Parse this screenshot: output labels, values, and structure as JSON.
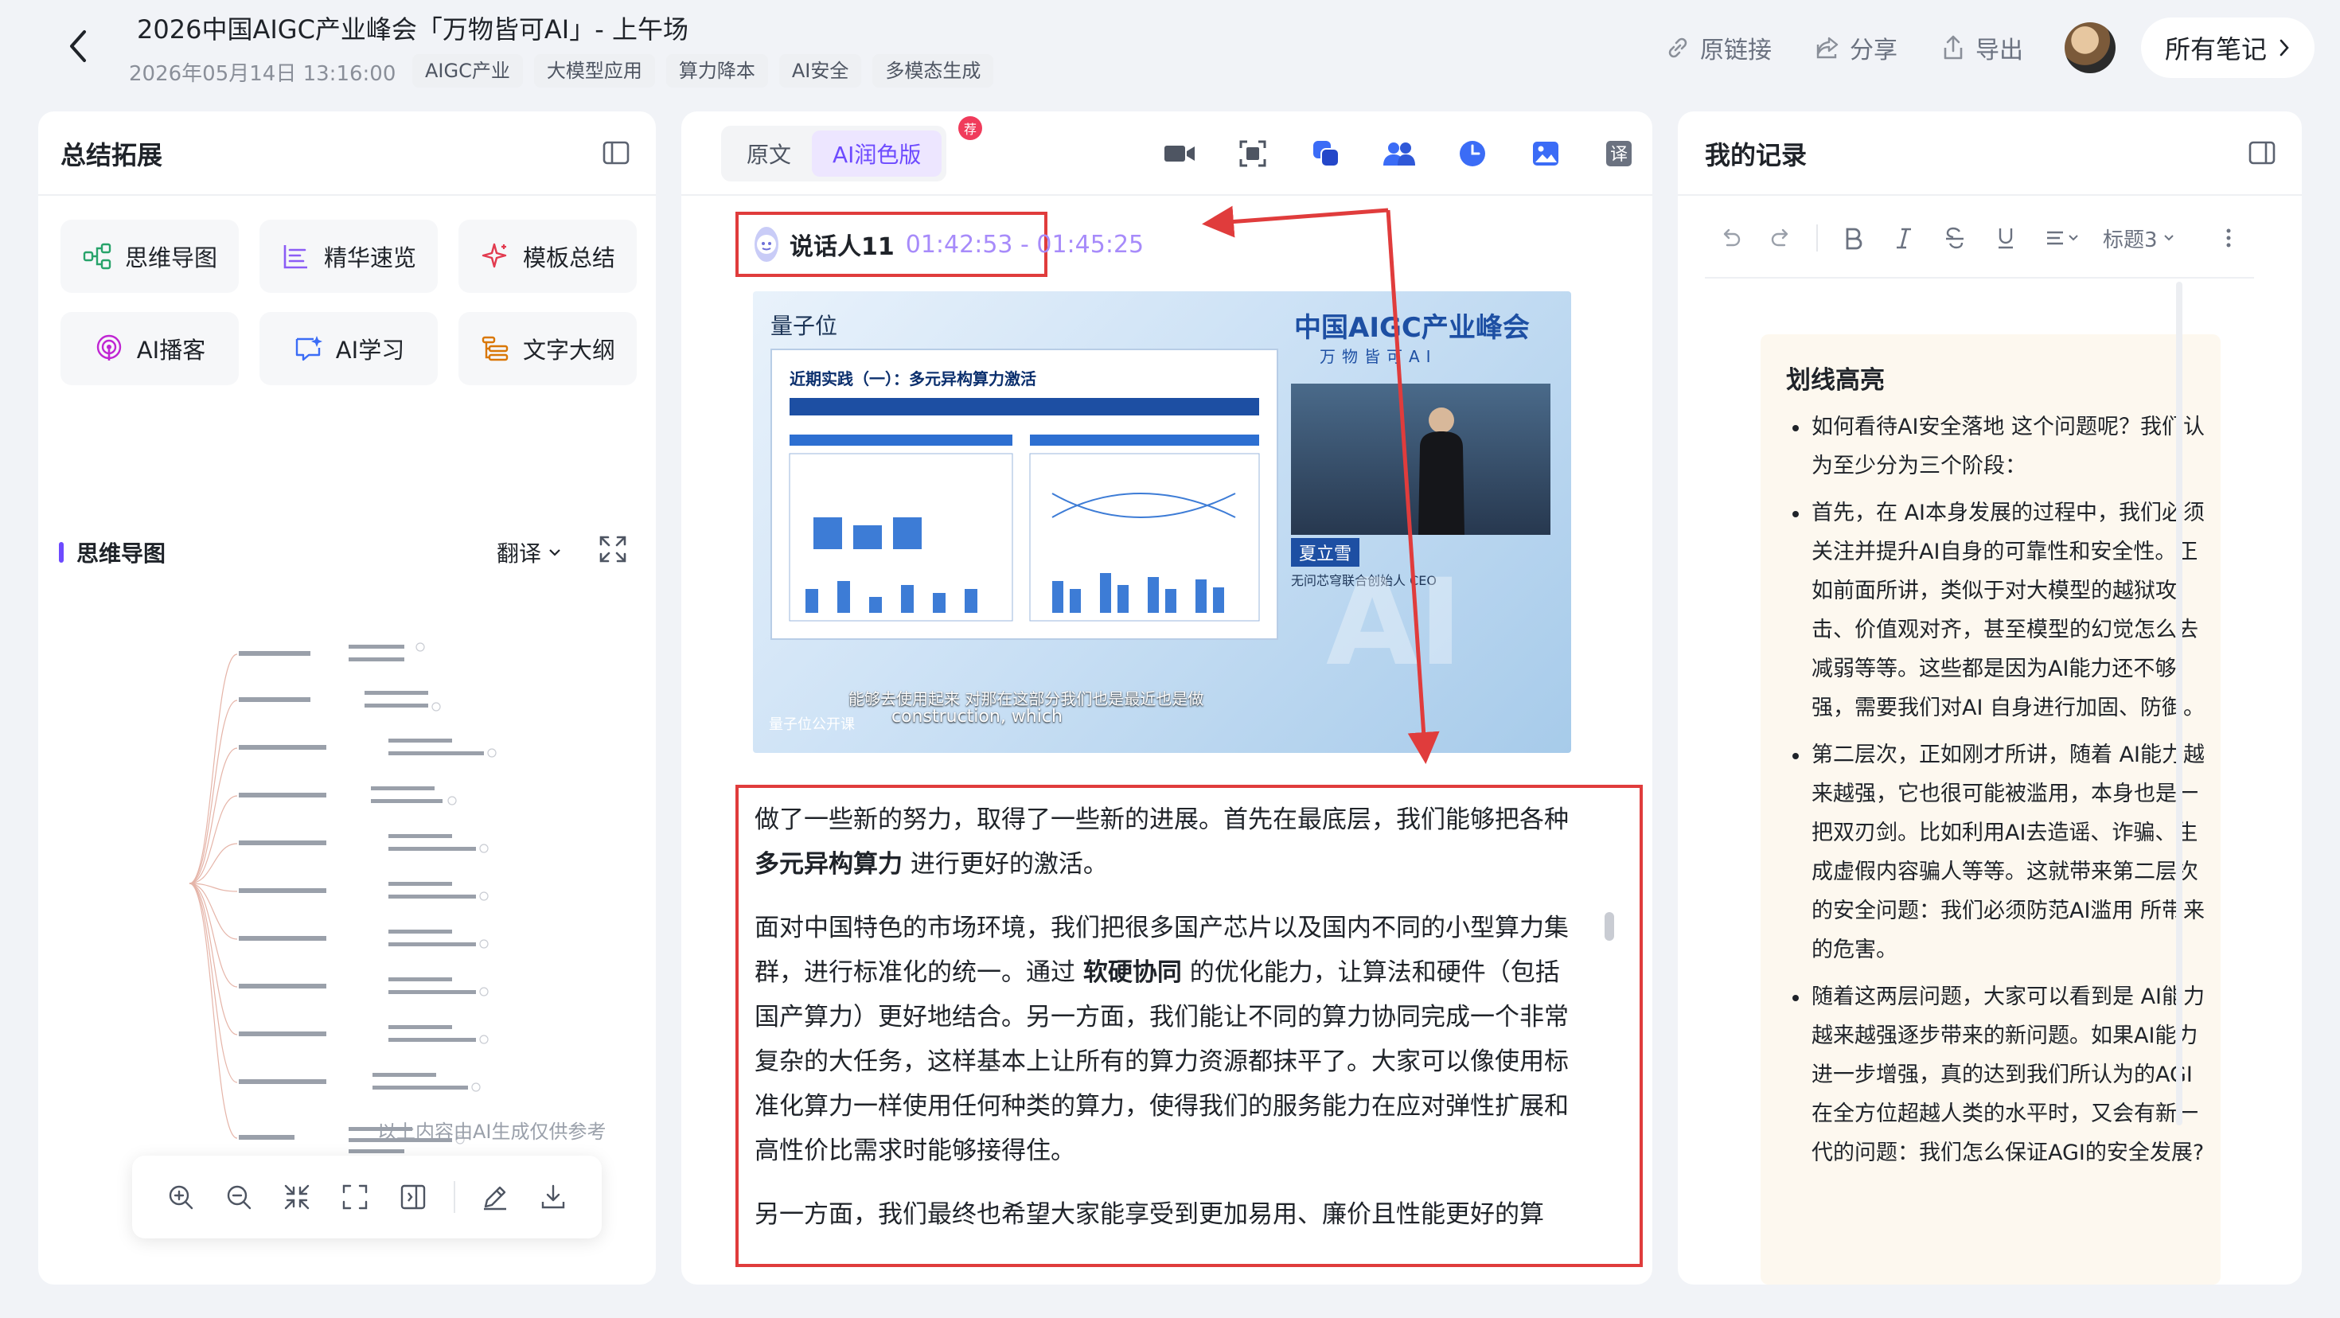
{
  "header": {
    "title": "2026中国AIGC产业峰会「万物皆可AI」- 上午场",
    "datetime": "2026年05月14日 13:16:00",
    "tags": [
      "AIGC产业",
      "大模型应用",
      "算力降本",
      "AI安全",
      "多模态生成"
    ],
    "actions": {
      "origin_link": "原链接",
      "share": "分享",
      "export": "导出"
    },
    "all_notes": "所有笔记"
  },
  "left": {
    "title": "总结拓展",
    "tools": [
      "思维导图",
      "精华速览",
      "模板总结",
      "AI播客",
      "AI学习",
      "文字大纲"
    ],
    "mindmap_title": "思维导图",
    "translate": "翻译",
    "ai_note": "以上内容由AI生成仅供参考"
  },
  "middle": {
    "tabs": [
      "原文",
      "AI润色版"
    ],
    "badge": "荐",
    "speaker": "说话人11",
    "time_range": "01:42:53 - 01:45:25",
    "video": {
      "brand": "量子位",
      "conference": "中国AIGC产业峰会",
      "conference_sub": "万物皆可AI",
      "slide_title": "近期实践（一）：多元异构算力激活",
      "speaker_name": "夏立雪",
      "speaker_role": "无问芯穹联合创始人 CEO",
      "subtitle_cn": "能够去使用起来 对那在这部分我们也是最近也是做",
      "subtitle_en": "construction, which",
      "watermark": "量子位公开课"
    },
    "transcript": {
      "p1_a": "做了一些新的努力，取得了一些新的进展。首先在最底层，我们能够把各种 ",
      "p1_b": "多元异构算力",
      "p1_c": " 进行更好的激活。",
      "p2_a": "面对中国特色的市场环境，我们把很多国产芯片以及国内不同的小型算力集群，进行标准化的统一。通过 ",
      "p2_b": "软硬协同",
      "p2_c": " 的优化能力，让算法和硬件（包括国产算力）更好地结合。另一方面，我们能让不同的算力协同完成一个非常复杂的大任务，这样基本上让所有的算力资源都抹平了。大家可以像使用标准化算力一样使用任何种类的算力，使得我们的服务能力在应对弹性扩展和高性价比需求时能够接得住。",
      "p3": "另一方面，我们最终也希望大家能享受到更加易用、廉价且性能更好的算"
    }
  },
  "right": {
    "title": "我的记录",
    "heading_select": "标题3",
    "highlight_title": "划线高亮",
    "highlights": [
      "如何看待AI安全落地 这个问题呢？我们认为至少分为三个阶段：",
      "首先，在 AI本身发展的过程中，我们必须关注并提升AI自身的可靠性和安全性。正如前面所讲，类似于对大模型的越狱攻击、价值观对齐，甚至模型的幻觉怎么去减弱等等。这些都是因为AI能力还不够强，需要我们对AI 自身进行加固、防御。",
      "第二层次，正如刚才所讲，随着 AI能力越来越强，它也很可能被滥用，本身也是一把双刃剑。比如利用AI去造谣、诈骗、生成虚假内容骗人等等。这就带来第二层次的安全问题：我们必须防范AI滥用 所带来的危害。",
      "随着这两层问题，大家可以看到是 AI能力越来越强逐步带来的新问题。如果AI能力进一步增强，真的达到我们所认为的AGI在全方位超越人类的水平时，又会有新一代的问题：我们怎么保证AGI的安全发展?"
    ]
  },
  "colors": {
    "accent": "#6d4aff",
    "annotation_red": "#e03c3c"
  }
}
